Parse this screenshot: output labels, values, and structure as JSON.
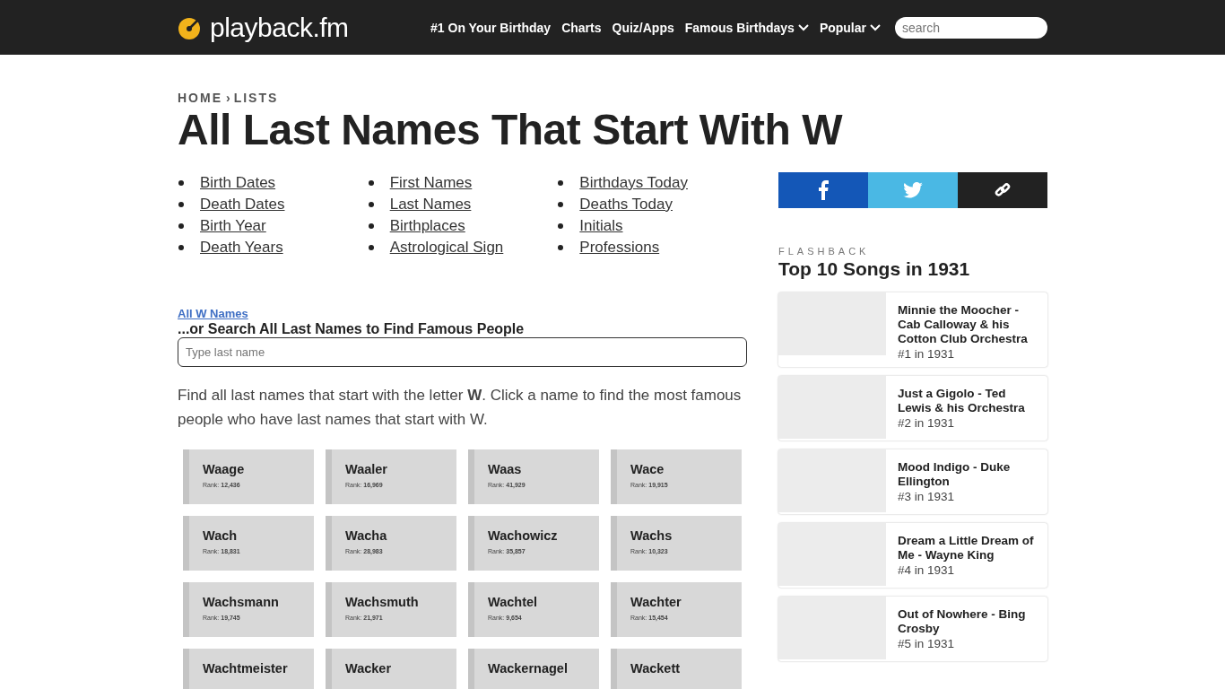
{
  "header": {
    "logo": "playback.fm",
    "nav": [
      {
        "label": "#1 On Your Birthday",
        "dropdown": false
      },
      {
        "label": "Charts",
        "dropdown": false
      },
      {
        "label": "Quiz/Apps",
        "dropdown": false
      },
      {
        "label": "Famous Birthdays",
        "dropdown": true
      },
      {
        "label": "Popular",
        "dropdown": true
      }
    ],
    "search": {
      "placeholder": "search"
    }
  },
  "breadcrumb": [
    "HOME",
    "LISTS"
  ],
  "breadcrumb_separator": "›",
  "title": "All Last Names That Start With W",
  "link_columns": [
    [
      "Birth Dates",
      "Death Dates",
      "Birth Year",
      "Death Years"
    ],
    [
      "First Names",
      "Last Names",
      "Birthplaces",
      "Astrological Sign"
    ],
    [
      "Birthdays Today",
      "Deaths Today",
      "Initials",
      "Professions"
    ]
  ],
  "all_names_link": "All W Names",
  "search_heading": "...or Search All Last Names to Find Famous People",
  "name_search": {
    "placeholder": "Type last name"
  },
  "intro": "Find all last names that start with the letter **W**. Click a name to find the most famous people who have last names that start with W.",
  "names": [
    {
      "name": "Waage",
      "rank": "Rank: **12,436**"
    },
    {
      "name": "Waaler",
      "rank": "Rank: **16,969**"
    },
    {
      "name": "Waas",
      "rank": "Rank: **41,929**"
    },
    {
      "name": "Wace",
      "rank": "Rank: **19,915**"
    },
    {
      "name": "Wach",
      "rank": "Rank: **18,831**"
    },
    {
      "name": "Wacha",
      "rank": "Rank: **28,983**"
    },
    {
      "name": "Wachowicz",
      "rank": "Rank: **35,857**"
    },
    {
      "name": "Wachs",
      "rank": "Rank: **10,323**"
    },
    {
      "name": "Wachsmann",
      "rank": "Rank: **19,745**"
    },
    {
      "name": "Wachsmuth",
      "rank": "Rank: **21,971**"
    },
    {
      "name": "Wachtel",
      "rank": "Rank: **9,654**"
    },
    {
      "name": "Wachter",
      "rank": "Rank: **15,454**"
    },
    {
      "name": "Wachtmeister"
    },
    {
      "name": "Wacker"
    },
    {
      "name": "Wackernagel"
    },
    {
      "name": "Wackett"
    }
  ],
  "share": [
    {
      "kind": "facebook",
      "color": "#1457b7"
    },
    {
      "kind": "twitter",
      "color": "#4ab8e4"
    },
    {
      "kind": "link",
      "color": "#222222"
    }
  ],
  "flashback": {
    "label": "FLASHBACK",
    "title": "Top 10 Songs in 1931",
    "songs": [
      {
        "title": "Minnie the Moocher - Cab Calloway & his Cotton Club Orchestra",
        "rank": "#1 in 1931"
      },
      {
        "title": "Just a Gigolo - Ted Lewis & his Orchestra",
        "rank": "#2 in 1931"
      },
      {
        "title": "Mood Indigo - Duke Ellington",
        "rank": "#3 in 1931"
      },
      {
        "title": "Dream a Little Dream of Me - Wayne King",
        "rank": "#4 in 1931"
      },
      {
        "title": "Out of Nowhere - Bing Crosby",
        "rank": "#5 in 1931"
      }
    ]
  }
}
